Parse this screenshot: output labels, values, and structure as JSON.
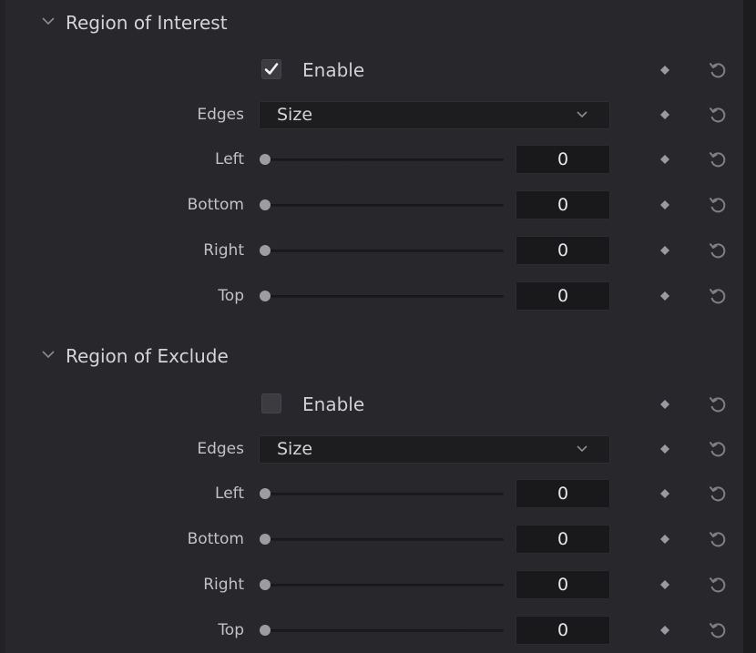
{
  "sections": [
    {
      "title": "Region of Interest",
      "expanded": true,
      "enable": {
        "label": "Enable",
        "checked": true
      },
      "edges": {
        "label": "Edges",
        "value": "Size"
      },
      "sliders": [
        {
          "label": "Left",
          "value": "0"
        },
        {
          "label": "Bottom",
          "value": "0"
        },
        {
          "label": "Right",
          "value": "0"
        },
        {
          "label": "Top",
          "value": "0"
        }
      ]
    },
    {
      "title": "Region of Exclude",
      "expanded": true,
      "enable": {
        "label": "Enable",
        "checked": false
      },
      "edges": {
        "label": "Edges",
        "value": "Size"
      },
      "sliders": [
        {
          "label": "Left",
          "value": "0"
        },
        {
          "label": "Bottom",
          "value": "0"
        },
        {
          "label": "Right",
          "value": "0"
        },
        {
          "label": "Top",
          "value": "0"
        }
      ]
    }
  ],
  "icons": {
    "section_toggle": "chevron-down-icon",
    "keyframe": "diamond-icon",
    "reset": "reset-arrow-icon",
    "dropdown": "chevron-down-icon",
    "check": "checkmark-icon"
  },
  "colors": {
    "background": "#28282c",
    "field": "#19191b",
    "text": "#c9c9cc",
    "thumb": "#9c9ca1"
  }
}
